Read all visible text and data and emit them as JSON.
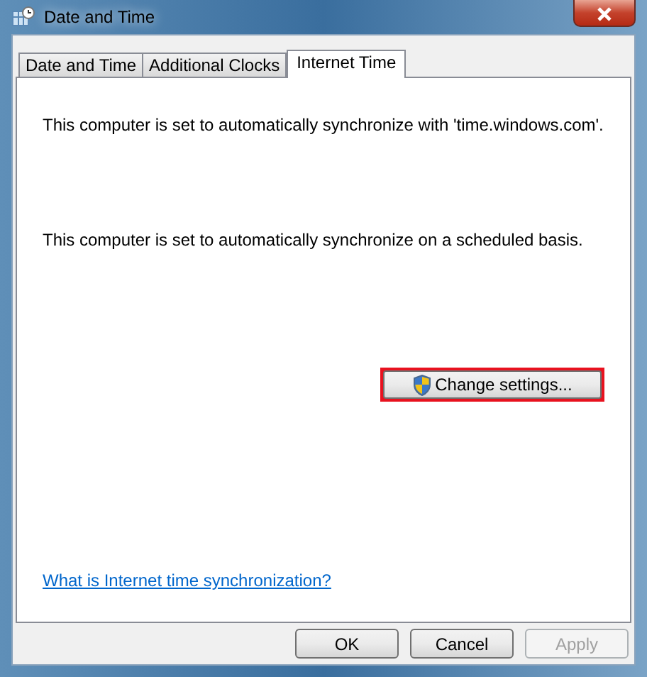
{
  "window": {
    "title": "Date and Time"
  },
  "tabs": [
    {
      "label": "Date and Time",
      "selected": false
    },
    {
      "label": "Additional Clocks",
      "selected": false
    },
    {
      "label": "Internet Time",
      "selected": true
    }
  ],
  "panel": {
    "status_text": "This computer is set to automatically synchronize with 'time.windows.com'.",
    "schedule_text": "This computer is set to automatically synchronize on a scheduled basis.",
    "change_button": {
      "label": "Change settings...",
      "highlighted": true
    },
    "help_link": "What is Internet time synchronization?"
  },
  "buttons": [
    {
      "label": "OK",
      "disabled": false
    },
    {
      "label": "Cancel",
      "disabled": false
    },
    {
      "label": "Apply",
      "disabled": true
    }
  ]
}
